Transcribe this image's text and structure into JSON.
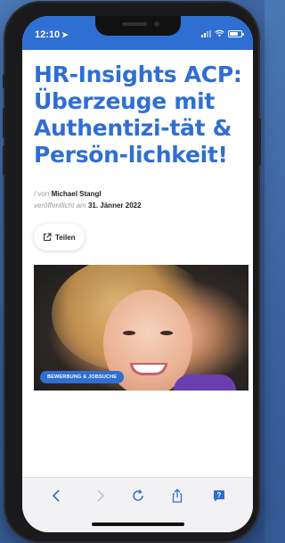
{
  "status_bar": {
    "time": "12:10",
    "location_arrow": "➤"
  },
  "article": {
    "title": "HR-Insights ACP: Überzeuge mit Authentizi-tät & Persön-lichkeit!",
    "by_prefix": "/ von",
    "author": "Michael Stangl",
    "published_prefix": "veröffentlicht am",
    "date": "31. Jänner 2022",
    "share_label": "Teilen",
    "category_badge": "BEWERBUNG & JOBSUCHE"
  },
  "colors": {
    "brand": "#2f6fd3",
    "toolbar_icons": "#2f6fd3",
    "toolbar_icons_disabled": "#b8c5db"
  },
  "toolbar": {
    "icons": [
      "back-arrow-icon",
      "forward-arrow-icon",
      "reload-icon",
      "share-icon",
      "help-icon"
    ],
    "help_glyph": "?"
  }
}
